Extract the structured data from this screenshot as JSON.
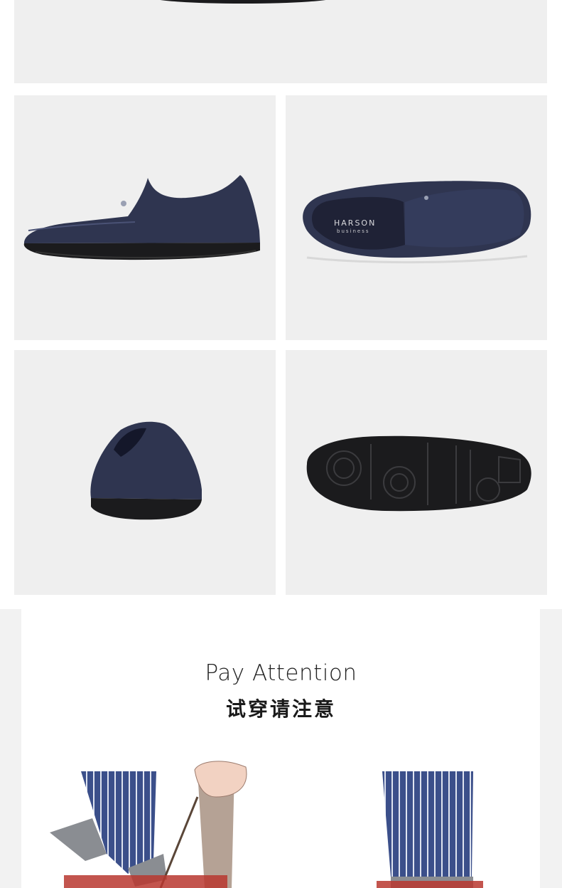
{
  "colors": {
    "panel_bg": "#efefef",
    "leather_navy": "#2f3550",
    "sole_black": "#1b1b1d",
    "stripe_blue": "#3b4f8a",
    "box_red": "#b8372f"
  },
  "insole_brand": {
    "name": "HARSON",
    "sub": "business"
  },
  "attention": {
    "title_en": "Pay Attention",
    "title_zh": "试穿请注意"
  }
}
